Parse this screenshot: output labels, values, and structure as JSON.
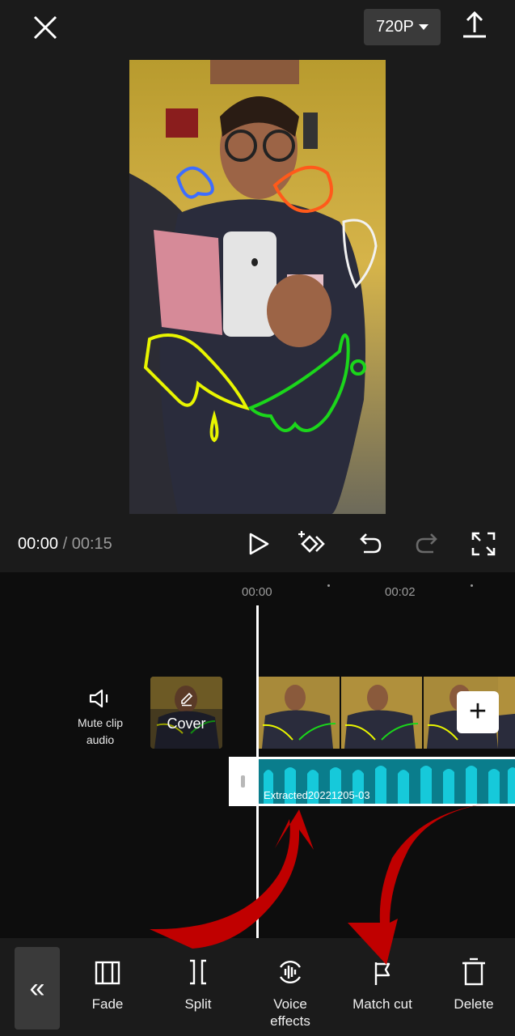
{
  "header": {
    "resolution_label": "720P",
    "close_icon": "close-icon",
    "export_icon": "export-icon"
  },
  "player": {
    "current_time": "00:00",
    "separator": "/",
    "total_time": "00:15"
  },
  "timeline": {
    "ticks": [
      "00:00",
      "00:02"
    ],
    "mute_label_line1": "Mute clip",
    "mute_label_line2": "audio",
    "cover_label": "Cover",
    "audio_clip_name": "Extracted20221205-03",
    "add_label": "+"
  },
  "toolbar": {
    "collapse_label": "«",
    "tools": [
      {
        "label": "Fade",
        "icon": "fade-icon"
      },
      {
        "label": "Split",
        "icon": "split-icon"
      },
      {
        "label_line1": "Voice",
        "label_line2": "effects",
        "icon": "voice-effects-icon"
      },
      {
        "label": "Match cut",
        "icon": "match-cut-icon"
      },
      {
        "label": "Delete",
        "icon": "delete-icon"
      }
    ]
  },
  "colors": {
    "audio_track": "#0a7d8c",
    "annotation_arrow": "#c00000",
    "panel": "#1b1b1b"
  }
}
